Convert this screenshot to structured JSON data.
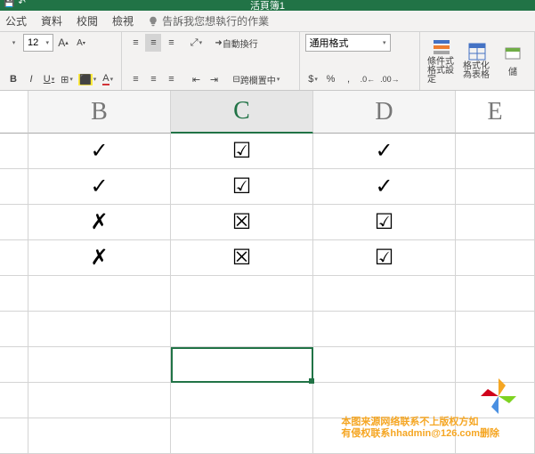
{
  "titlebar": {
    "title": "活頁簿1",
    "undo": "↶"
  },
  "menu": {
    "items": [
      "公式",
      "資料",
      "校閱",
      "檢視"
    ],
    "tellme": "告訴我您想執行的作業"
  },
  "ribbon": {
    "font_size": "12",
    "bold": "B",
    "italic": "I",
    "underline": "U",
    "wrap_label": "自動換行",
    "merge_label": "跨欄置中",
    "number_format": "通用格式",
    "currency": "$",
    "percent": "%",
    "comma": ",",
    "dec_inc": "←.0",
    "dec_dec": ".00→",
    "cond_fmt": "條件式格式設定",
    "as_table": "格式化為表格",
    "cell_style": "儲"
  },
  "columns": [
    "",
    "B",
    "C",
    "D",
    "E"
  ],
  "rows": [
    {
      "b": "✓",
      "c": "☑",
      "d": "✓"
    },
    {
      "b": "✓",
      "c": "☑",
      "d": "✓"
    },
    {
      "b": "✗",
      "c": "☒",
      "d": "☑"
    },
    {
      "b": "✗",
      "c": "☒",
      "d": "☑"
    },
    {
      "b": "",
      "c": "",
      "d": ""
    },
    {
      "b": "",
      "c": "",
      "d": ""
    }
  ],
  "watermark": {
    "line1": "本图来源网络联系不上版权方如",
    "line2": "有侵权联系hhadmin@126.com删除"
  }
}
